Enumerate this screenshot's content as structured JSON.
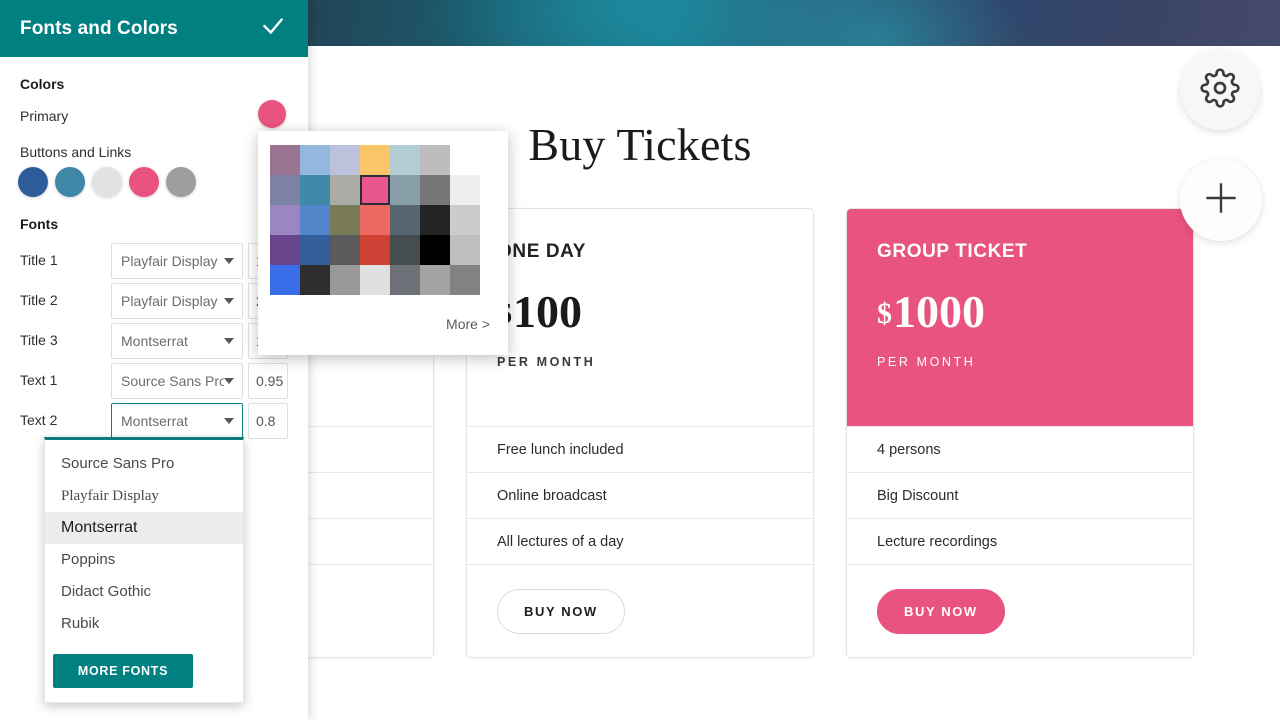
{
  "panel": {
    "title": "Fonts and Colors",
    "confirm_icon": "check-icon",
    "colors_section": "Colors",
    "primary_label": "Primary",
    "primary_color": "#e8537f",
    "buttons_links_label": "Buttons and  Links",
    "buttons_links_swatches": [
      "#2e5c9a",
      "#3f87a6",
      "#e2e2e2",
      "#ea527f",
      "#9e9e9e"
    ],
    "fonts_section": "Fonts",
    "font_rows": [
      {
        "label": "Title 1",
        "font": "Playfair Display",
        "size": "1"
      },
      {
        "label": "Title 2",
        "font": "Playfair Display",
        "size": "2"
      },
      {
        "label": "Title 3",
        "font": "Montserrat",
        "size": "1"
      },
      {
        "label": "Text 1",
        "font": "Source Sans Pro",
        "size": "0.95"
      },
      {
        "label": "Text 2",
        "font": "Montserrat",
        "size": "0.8"
      }
    ]
  },
  "font_dropdown": {
    "options": [
      "Source Sans Pro",
      "Playfair Display",
      "Montserrat",
      "Poppins",
      "Didact Gothic",
      "Rubik"
    ],
    "selected": "Montserrat",
    "more_fonts_label": "MORE FONTS"
  },
  "color_picker": {
    "more_label": "More >",
    "selected_index": 10,
    "swatches": [
      "#9c7493",
      "#93b8dd",
      "#bcc1dc",
      "#fac566",
      "#b3cdd4",
      "#bdbdbd",
      "#ffffff",
      "#7c82a6",
      "#4189a8",
      "#acaca7",
      "#e8568d",
      "#889fa8",
      "#777777",
      "#efefef",
      "#9c86c1",
      "#5286cb",
      "#7a7c58",
      "#ec6a62",
      "#57666e",
      "#242424",
      "#cccccc",
      "#67448c",
      "#345d9b",
      "#5b5b5e",
      "#cf4134",
      "#454d50",
      "#000000",
      "#bfbfbf",
      "#3a6ee8",
      "#2e2e2e",
      "#999999",
      "#e0e0e0",
      "#6d7076",
      "#a3a3a3",
      "#828282"
    ]
  },
  "site": {
    "page_title": "Buy Tickets",
    "gear_icon": "gear-icon",
    "plus_icon": "plus-icon",
    "cards": [
      {
        "name": "",
        "currency": "",
        "price": "",
        "period": "",
        "features": [
          "",
          "",
          ""
        ],
        "buy_label": ""
      },
      {
        "name": "ONE DAY",
        "currency": "$",
        "price": "100",
        "period": "PER MONTH",
        "features": [
          "Free lunch included",
          "Online broadcast",
          "All lectures of a day"
        ],
        "buy_label": "BUY NOW"
      },
      {
        "name": "GROUP TICKET",
        "currency": "$",
        "price": "1000",
        "period": "PER MONTH",
        "features": [
          "4 persons",
          "Big Discount",
          "Lecture recordings"
        ],
        "buy_label": "BUY NOW"
      }
    ]
  }
}
